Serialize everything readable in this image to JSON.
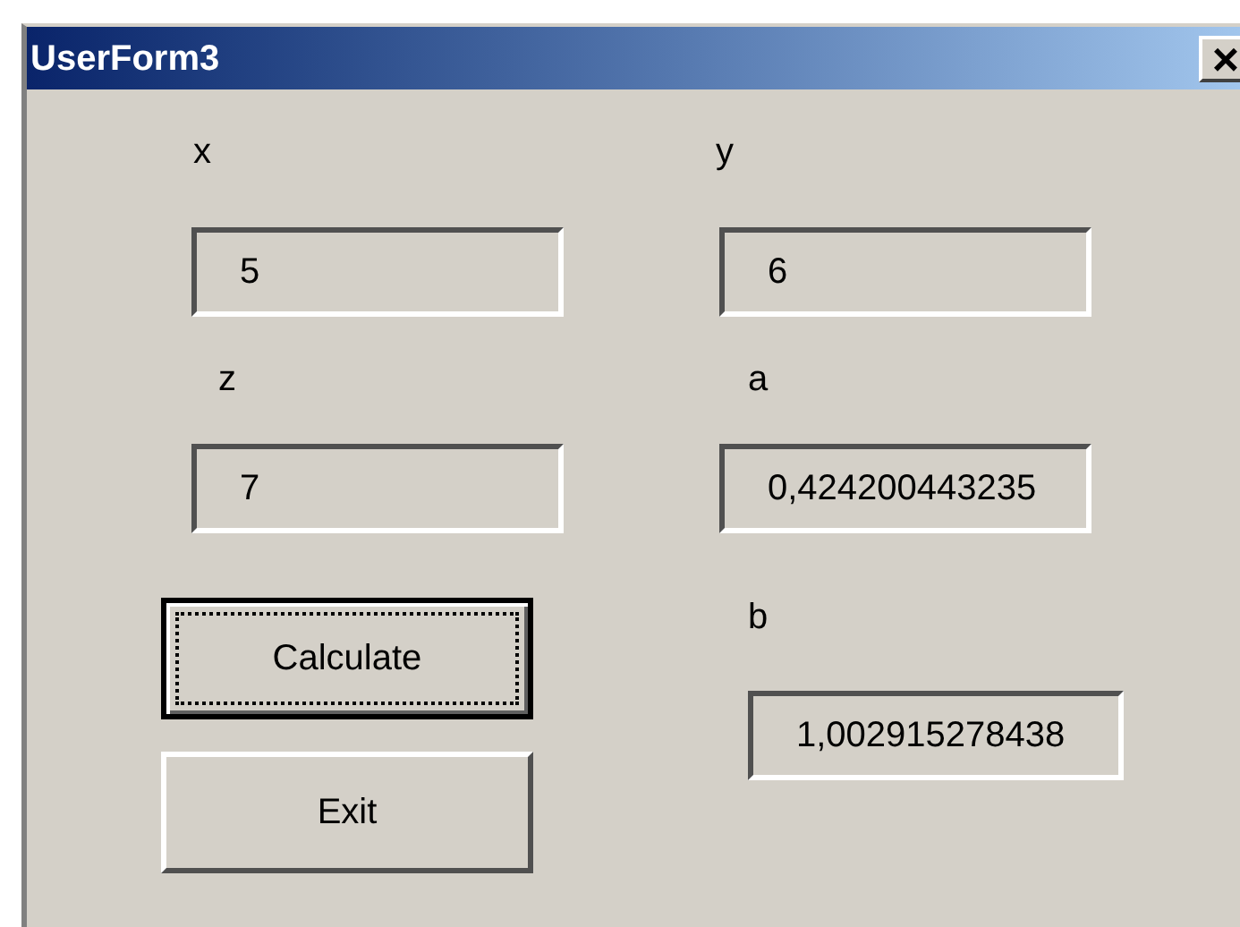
{
  "window": {
    "title": "UserForm3",
    "close": "×"
  },
  "labels": [
    {
      "text": "x"
    },
    {
      "text": "y"
    },
    {
      "text": "z"
    },
    {
      "text": "a"
    },
    {
      "text": "b"
    }
  ],
  "fields": [
    {
      "value": "5"
    },
    {
      "value": "6"
    },
    {
      "value": "7"
    },
    {
      "value": "0,424200443235"
    },
    {
      "value": "1,002915278438"
    }
  ],
  "buttons": [
    {
      "label": "Calculate",
      "focused": true
    },
    {
      "label": "Exit",
      "focused": false
    }
  ]
}
